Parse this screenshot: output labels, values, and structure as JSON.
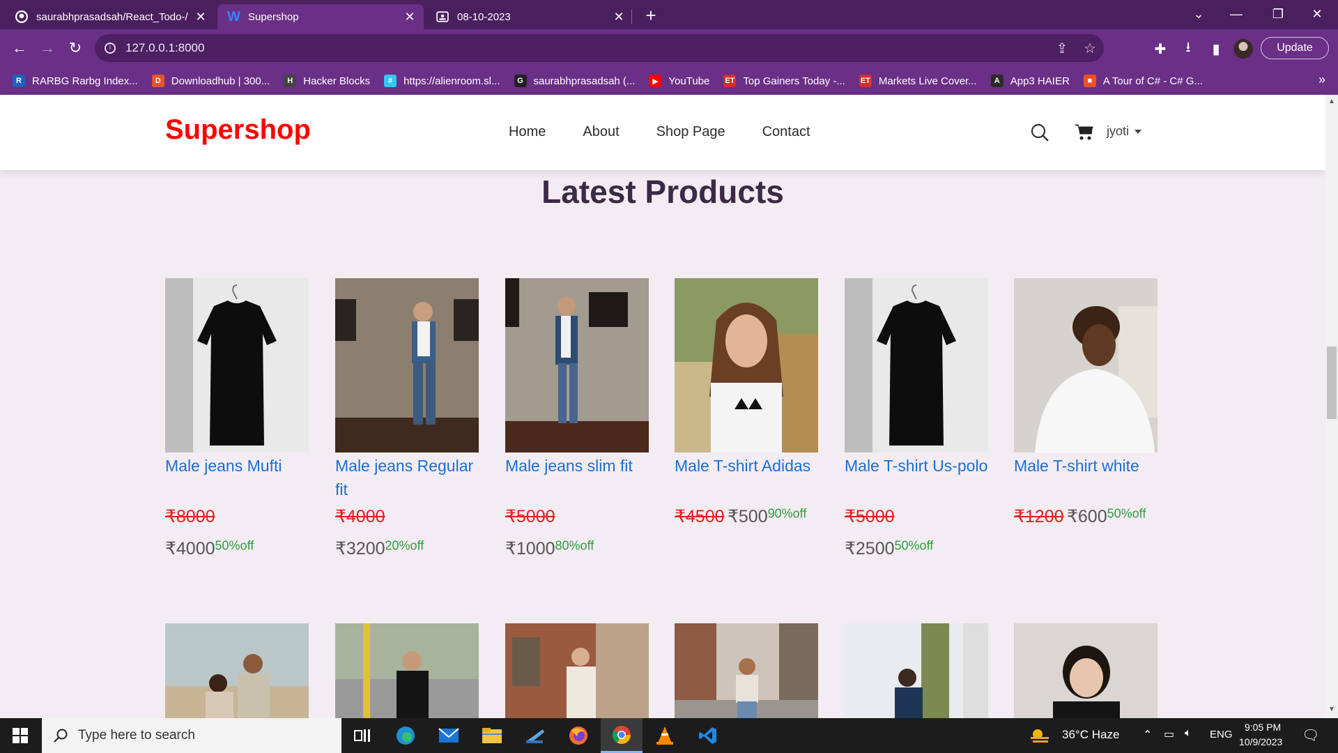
{
  "browser": {
    "tabs": [
      {
        "title": "saurabhprasadsah/React_Todo-/",
        "icon": "github-icon",
        "active": false
      },
      {
        "title": "Supershop",
        "icon": "w-icon",
        "active": true
      },
      {
        "title": "08-10-2023",
        "icon": "image-icon",
        "active": false
      }
    ],
    "new_tab_label": "+",
    "url": "127.0.0.1:8000",
    "update_label": "Update",
    "bookmarks": [
      {
        "label": "RARBG Rarbg Index...",
        "icon": "R",
        "color": "#1f5fbf"
      },
      {
        "label": "Downloadhub | 300...",
        "icon": "D",
        "color": "#e8542a"
      },
      {
        "label": "Hacker Blocks",
        "icon": "H",
        "color": "#444444"
      },
      {
        "label": "https://alienroom.sl...",
        "icon": "#",
        "color": "#36c5f0"
      },
      {
        "label": "saurabhprasadsah (...",
        "icon": "G",
        "color": "#222222"
      },
      {
        "label": "YouTube",
        "icon": "▶",
        "color": "#ff0000"
      },
      {
        "label": "Top Gainers Today -...",
        "icon": "ET",
        "color": "#d32f2f"
      },
      {
        "label": "Markets Live Cover...",
        "icon": "ET",
        "color": "#d32f2f"
      },
      {
        "label": "App3 HAIER",
        "icon": "A",
        "color": "#2a2a2a"
      },
      {
        "label": "A Tour of C# - C# G...",
        "icon": "■",
        "color": "#f25022"
      }
    ],
    "bookmarks_more": "»"
  },
  "site": {
    "logo": "Supershop",
    "menu": [
      "Home",
      "About",
      "Shop Page",
      "Contact"
    ],
    "user": "jyoti",
    "section_title": "Latest Products"
  },
  "products": [
    {
      "name": "Male jeans Mufti",
      "old_price": "₹8000",
      "new_price": "₹4000",
      "discount": "50%off",
      "inline": false
    },
    {
      "name": "Male jeans Regular fit",
      "old_price": "₹4000",
      "new_price": "₹3200",
      "discount": "20%off",
      "inline": false
    },
    {
      "name": "Male jeans slim fit",
      "old_price": "₹5000",
      "new_price": "₹1000",
      "discount": "80%off",
      "inline": false
    },
    {
      "name": "Male T-shirt Adidas",
      "old_price": "₹4500",
      "new_price": "₹500",
      "discount": "90%off",
      "inline": true
    },
    {
      "name": "Male T-shirt Us-polo",
      "old_price": "₹5000",
      "new_price": "₹2500",
      "discount": "50%off",
      "inline": false
    },
    {
      "name": "Male T-shirt white",
      "old_price": "₹1200",
      "new_price": "₹600",
      "discount": "50%off",
      "inline": true
    }
  ],
  "taskbar": {
    "search_placeholder": "Type here to search",
    "weather": "36°C  Haze",
    "language": "ENG",
    "time": "9:05 PM",
    "date": "10/9/2023"
  }
}
